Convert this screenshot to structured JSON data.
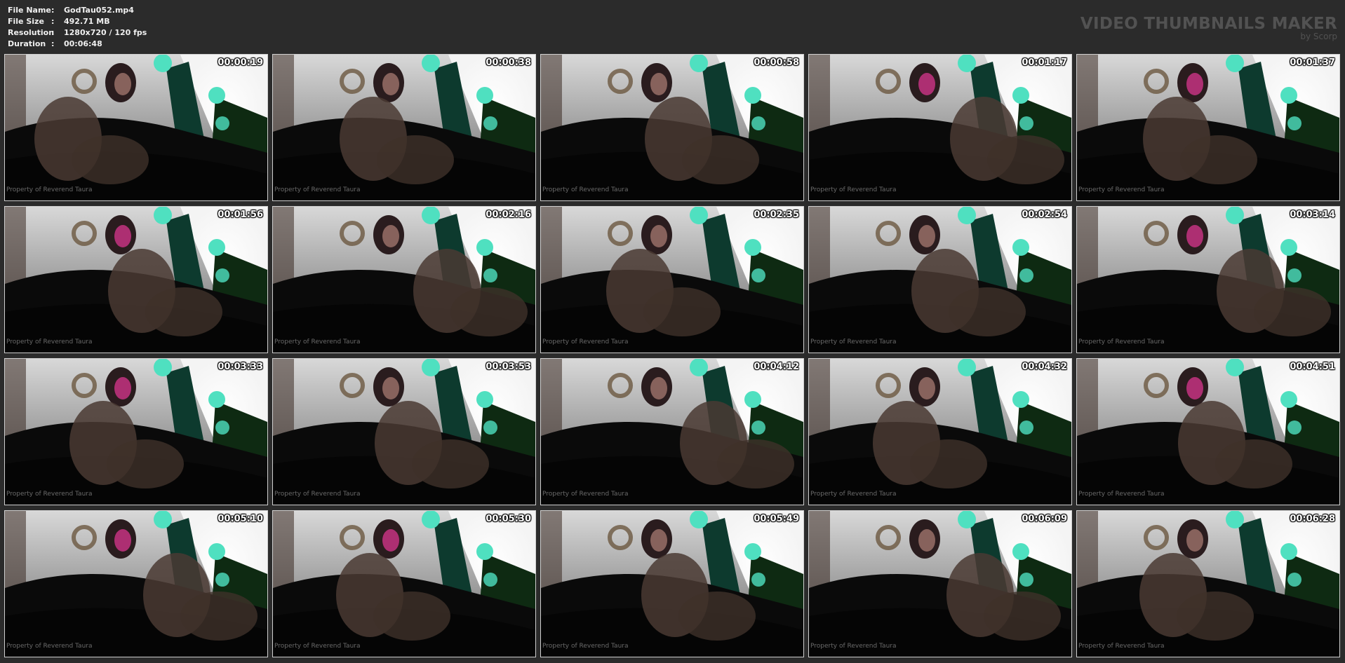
{
  "file_info": {
    "rows": [
      {
        "key": "File Name",
        "sep": ":",
        "value": "GodTau052.mp4"
      },
      {
        "key": "File Size",
        "sep": ":",
        "value": "492.71 MB"
      },
      {
        "key": "Resolution",
        "sep": ":",
        "value": "1280x720 / 120 fps"
      },
      {
        "key": "Duration",
        "sep": ":",
        "value": "00:06:48"
      }
    ]
  },
  "brand": {
    "title": "VIDEO THUMBNAILS MAKER",
    "subtitle": "by Scorp"
  },
  "thumbnails": [
    {
      "time": "00:00:19",
      "watermark": "Property of Reverend Taura"
    },
    {
      "time": "00:00:38",
      "watermark": "Property of Reverend Taura"
    },
    {
      "time": "00:00:58",
      "watermark": "Property of Reverend Taura"
    },
    {
      "time": "00:01:17",
      "watermark": "Property of Reverend Taura"
    },
    {
      "time": "00:01:37",
      "watermark": "Property of Reverend Taura"
    },
    {
      "time": "00:01:56",
      "watermark": "Property of Reverend Taura"
    },
    {
      "time": "00:02:16",
      "watermark": "Property of Reverend Taura"
    },
    {
      "time": "00:02:35",
      "watermark": "Property of Reverend Taura"
    },
    {
      "time": "00:02:54",
      "watermark": "Property of Reverend Taura"
    },
    {
      "time": "00:03:14",
      "watermark": "Property of Reverend Taura"
    },
    {
      "time": "00:03:33",
      "watermark": "Property of Reverend Taura"
    },
    {
      "time": "00:03:53",
      "watermark": "Property of Reverend Taura"
    },
    {
      "time": "00:04:12",
      "watermark": "Property of Reverend Taura"
    },
    {
      "time": "00:04:32",
      "watermark": "Property of Reverend Taura"
    },
    {
      "time": "00:04:51",
      "watermark": "Property of Reverend Taura"
    },
    {
      "time": "00:05:10",
      "watermark": "Property of Reverend Taura"
    },
    {
      "time": "00:05:30",
      "watermark": "Property of Reverend Taura"
    },
    {
      "time": "00:05:49",
      "watermark": "Property of Reverend Taura"
    },
    {
      "time": "00:06:09",
      "watermark": "Property of Reverend Taura"
    },
    {
      "time": "00:06:28",
      "watermark": "Property of Reverend Taura"
    }
  ],
  "colors": {
    "background": "#2b2b2b",
    "thumb_border": "#cfcfcf",
    "brand_text": "#525252",
    "lamp": "#4fe0c0",
    "pink_light": "#d9368f"
  }
}
